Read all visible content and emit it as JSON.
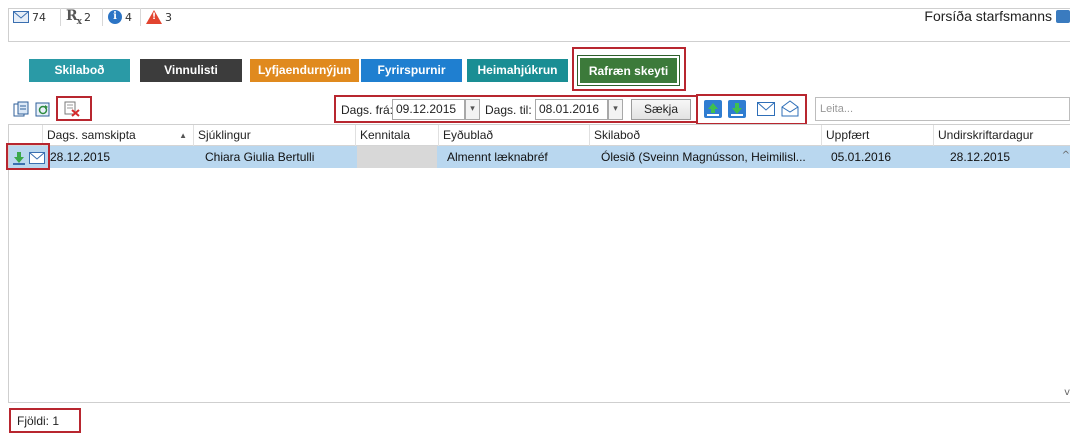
{
  "notifications": [
    {
      "icon": "mail-icon",
      "count": "74"
    },
    {
      "icon": "rx-icon",
      "symbol": "R",
      "sub": "x",
      "count": "2"
    },
    {
      "icon": "info-icon",
      "symbol": "i",
      "count": "4"
    },
    {
      "icon": "warning-icon",
      "count": "3"
    }
  ],
  "header": {
    "title": "Forsíða starfsmanns"
  },
  "nav": [
    {
      "label": "Skilaboð",
      "color": "#2a9aa6"
    },
    {
      "label": "Vinnulisti",
      "color": "#3c3c3c"
    },
    {
      "label": "Lyfjaendurnýjun",
      "color": "#e08a1e"
    },
    {
      "label": "Fyrirspurnir",
      "color": "#1f7fd0"
    },
    {
      "label": "Heimahjúkrun",
      "color": "#1a8e94"
    },
    {
      "label": "Rafræn skeyti",
      "color": "#3c7a3a"
    }
  ],
  "filter": {
    "from_label": "Dags. frá:",
    "from_value": "09.12.2015",
    "to_label": "Dags. til:",
    "to_value": "08.01.2016",
    "fetch_label": "Sækja",
    "search_placeholder": "Leita..."
  },
  "table": {
    "columns": [
      "Dags. samskipta",
      "Sjúklingur",
      "Kennitala",
      "Eyðublað",
      "Skilaboð",
      "Uppfært",
      "Undirskriftardagur"
    ],
    "rows": [
      {
        "date": "28.12.2015",
        "patient": "Chiara Giulia Bertulli",
        "kennitala": "",
        "form": "Almennt læknabréf",
        "message": "Ólesið (Sveinn Magnússon, Heimilisl...",
        "updated": "05.01.2016",
        "signed": "28.12.2015"
      }
    ]
  },
  "footer": {
    "count_label": "Fjöldi: 1"
  },
  "colors": {
    "accent_red": "#b8262f",
    "selected_row": "#b9d7ef",
    "green_icon": "#3aa84a",
    "blue_icon": "#2f7dd1"
  }
}
